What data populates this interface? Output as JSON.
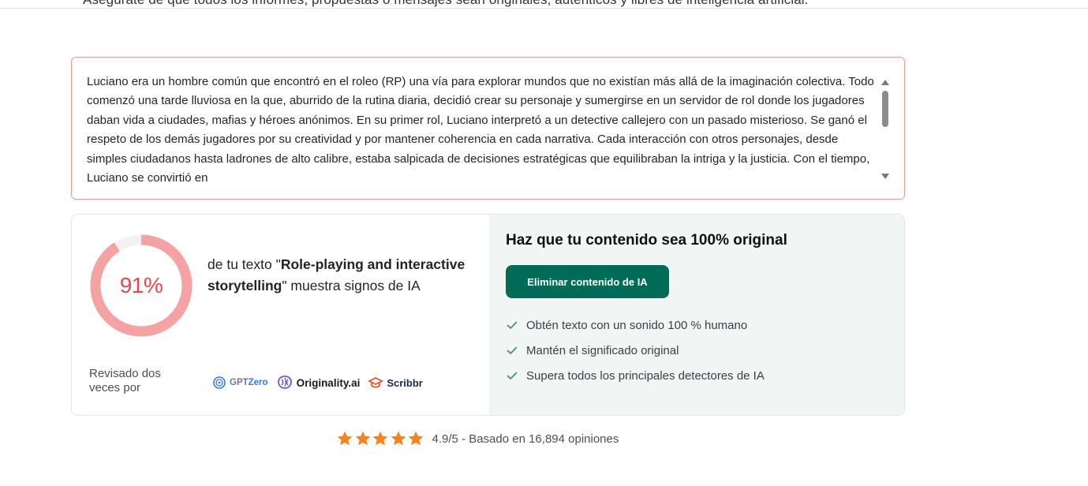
{
  "header": {
    "subtitle": "Asegúrate de que todos los informes, propuestas o mensajes sean originales, auténticos y libres de inteligencia artificial."
  },
  "input_text": "Luciano era un hombre común que encontró en el roleo (RP) una vía para explorar mundos que no existían más allá de la imaginación colectiva. Todo comenzó una tarde lluviosa en la que, aburrido de la rutina diaria, decidió crear su personaje y sumergirse en un servidor de rol donde los jugadores daban vida a ciudades, mafias y héroes anónimos. En su primer rol, Luciano interpretó a un detective callejero con un pasado misterioso. Se ganó el respeto de los demás jugadores por su creatividad y por mantener coherencia en cada narrativa. Cada interacción con otros personajes, desde simples ciudadanos hasta ladrones de alto calibre, estaba salpicada de decisiones estratégicas que equilibraban la intriga y la justicia. Con el tiempo, Luciano se convirtió en",
  "result": {
    "score_label": "91%",
    "score_value": 0.91,
    "text_prefix": "de tu texto \"",
    "title": "Role-playing and interactive storytelling",
    "text_suffix": "\" muestra signos de IA",
    "reviewed_label": "Revisado dos veces por",
    "logos": {
      "gptzero_prefix": "GPT",
      "gptzero_suffix": "Zero",
      "originality": "Originality.ai",
      "scribbr": "Scribbr"
    },
    "colors": {
      "score_text": "#e44848",
      "ring": "#f4a2a2",
      "ring_track": "#f2f2f2"
    }
  },
  "cta": {
    "title": "Haz que tu contenido sea 100% original",
    "button_label": "Eliminar contenido de IA",
    "features": [
      "Obtén texto con un sonido 100 % humano",
      "Mantén el significado original",
      "Supera todos los principales detectores de IA"
    ],
    "colors": {
      "button": "#006b56",
      "check": "#3f8f74",
      "panel": "#f1f6f5"
    }
  },
  "rating": {
    "stars": 5,
    "text": "4.9/5 - Basado en 16,894 opiniones",
    "colors": {
      "star": "#f4841f"
    }
  }
}
